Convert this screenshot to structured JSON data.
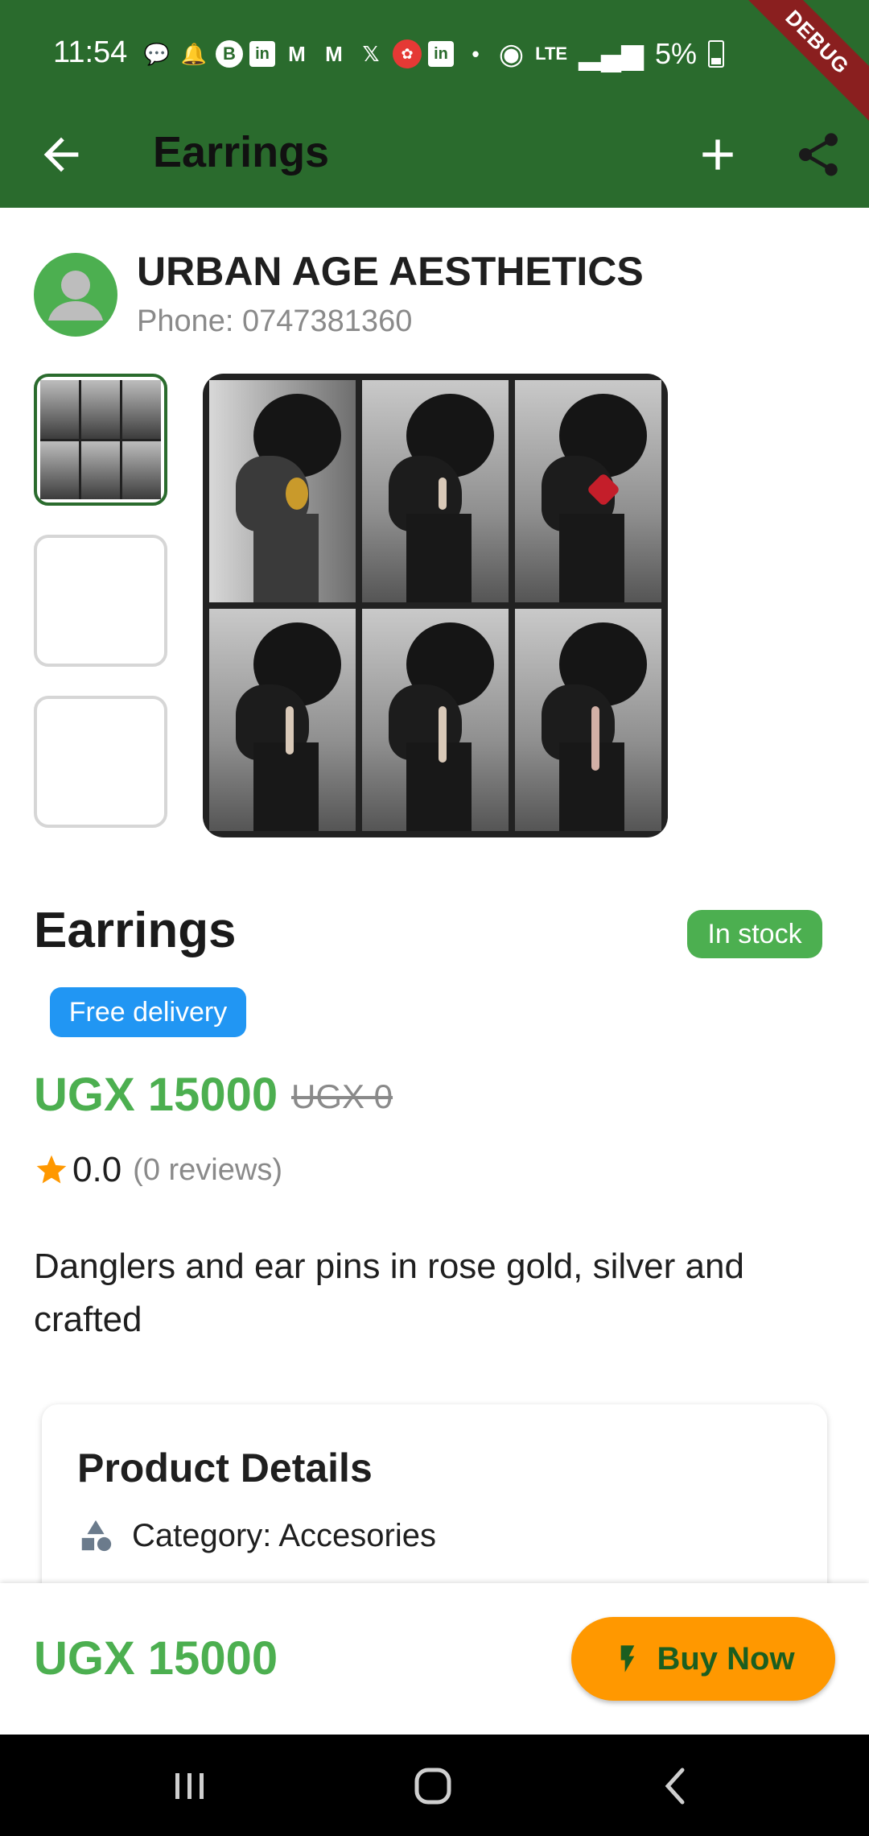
{
  "status_bar": {
    "time": "11:54",
    "battery": "5%",
    "network": "LTE",
    "debug_label": "DEBUG",
    "left_icons": [
      "chat-icon",
      "bell-icon",
      "b-icon",
      "linkedin-icon",
      "gmail-icon",
      "gmail-icon",
      "x-icon",
      "red-app-icon",
      "linkedin-icon",
      "dot-icon"
    ],
    "right_icons": [
      "hotspot-icon",
      "lte-icon",
      "signal-icon",
      "battery-icon"
    ]
  },
  "app_bar": {
    "title": "Earrings",
    "back_icon": "arrow-left-icon",
    "add_icon": "plus-icon",
    "share_icon": "share-icon"
  },
  "seller": {
    "name": "URBAN AGE AESTHETICS",
    "phone": "Phone: 0747381360"
  },
  "product": {
    "title": "Earrings",
    "stock_badge": "In stock",
    "delivery_badge": "Free delivery",
    "price": "UGX 15000",
    "old_price": "UGX 0",
    "rating": "0.0",
    "reviews": "(0 reviews)",
    "description": "Danglers and ear pins in rose gold, silver and crafted"
  },
  "details": {
    "title": "Product Details",
    "category": "Category: Accesories"
  },
  "bottom_bar": {
    "price": "UGX 15000",
    "buy_label": "Buy Now"
  },
  "colors": {
    "app_bar": "#2a6b2d",
    "price_green": "#4caf50",
    "stock_green": "#4caf50",
    "delivery_blue": "#2196f3",
    "buy_orange": "#ff9800",
    "star": "#ff9800"
  }
}
